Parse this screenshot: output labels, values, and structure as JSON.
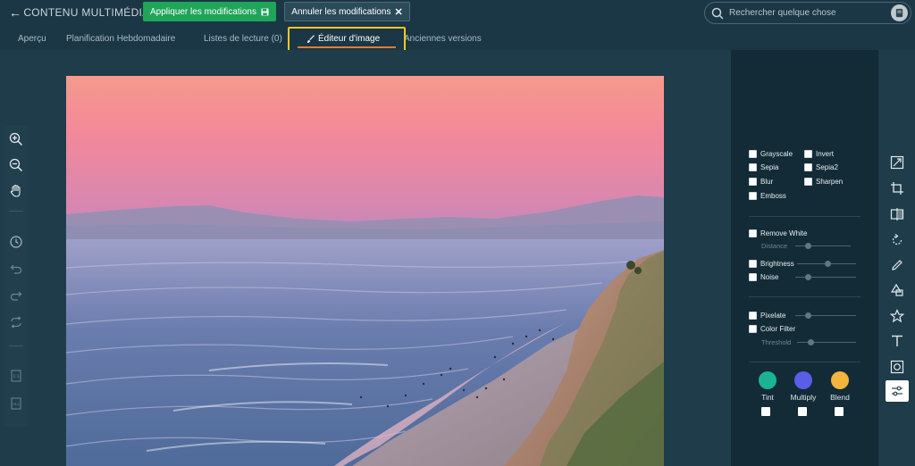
{
  "header": {
    "back_icon": "arrow-left-icon",
    "title": "CONTENU MULTIMÉDIA",
    "apply_label": "Appliquer les modifications",
    "apply_icon": "save-icon",
    "cancel_label": "Annuler les modifications",
    "cancel_icon": "close-icon",
    "search_placeholder": "Rechercher quelque chose",
    "search_icon": "search-icon",
    "avatar_icon": "user-avatar-icon"
  },
  "tabs": [
    {
      "label": "Aperçu"
    },
    {
      "label": "Planification Hebdomadaire"
    },
    {
      "label": "Listes de lecture (0)"
    },
    {
      "label": "Éditeur d'image",
      "icon": "brush-icon",
      "active": true
    },
    {
      "label": "Anciennes versions"
    }
  ],
  "colors": {
    "accent_orange": "#e07b39",
    "highlight_yellow": "#f2c824",
    "apply_green": "#1fa55a",
    "tint": "#1bb394",
    "multiply": "#5a5de6",
    "blend": "#f4b53d"
  },
  "left_tools": [
    "zoom-in-icon",
    "zoom-out-icon",
    "hand-pan-icon",
    "history-icon",
    "undo-icon",
    "redo-icon",
    "reset-icon",
    "fit-icon",
    "all-icon"
  ],
  "filters": {
    "grid": [
      {
        "label": "Grayscale"
      },
      {
        "label": "Invert"
      },
      {
        "label": "Sepia"
      },
      {
        "label": "Sepia2"
      },
      {
        "label": "Blur"
      },
      {
        "label": "Sharpen"
      },
      {
        "label": "Emboss"
      }
    ],
    "remove_white": {
      "label": "Remove White",
      "sub_label": "Distance"
    },
    "brightness": {
      "label": "Brightness"
    },
    "noise": {
      "label": "Noise"
    },
    "pixelate": {
      "label": "Pixelate"
    },
    "color_filter": {
      "label": "Color Filter",
      "sub_label": "Threshold"
    },
    "color_modes": [
      {
        "label": "Tint",
        "color": "#1bb394"
      },
      {
        "label": "Multiply",
        "color": "#5a5de6"
      },
      {
        "label": "Blend",
        "color": "#f4b53d"
      }
    ]
  },
  "right_tools": [
    "resize-icon",
    "crop-icon",
    "flip-icon",
    "rotate-icon",
    "draw-icon",
    "shape-icon",
    "star-icon",
    "text-icon",
    "mask-icon",
    "filter-icon"
  ]
}
